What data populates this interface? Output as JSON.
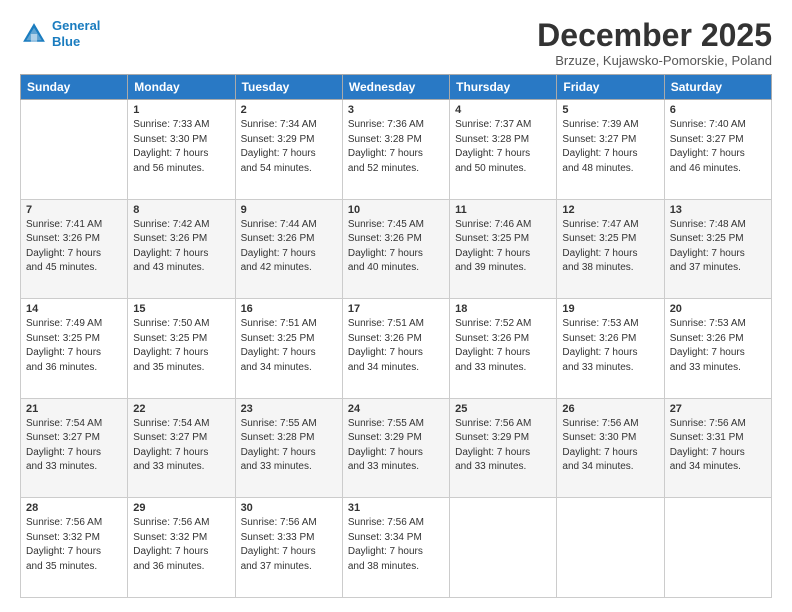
{
  "logo": {
    "line1": "General",
    "line2": "Blue"
  },
  "title": "December 2025",
  "location": "Brzuze, Kujawsko-Pomorskie, Poland",
  "weekdays": [
    "Sunday",
    "Monday",
    "Tuesday",
    "Wednesday",
    "Thursday",
    "Friday",
    "Saturday"
  ],
  "rows": [
    [
      {
        "day": "",
        "sunrise": "",
        "sunset": "",
        "daylight": ""
      },
      {
        "day": "1",
        "sunrise": "Sunrise: 7:33 AM",
        "sunset": "Sunset: 3:30 PM",
        "daylight": "Daylight: 7 hours and 56 minutes."
      },
      {
        "day": "2",
        "sunrise": "Sunrise: 7:34 AM",
        "sunset": "Sunset: 3:29 PM",
        "daylight": "Daylight: 7 hours and 54 minutes."
      },
      {
        "day": "3",
        "sunrise": "Sunrise: 7:36 AM",
        "sunset": "Sunset: 3:28 PM",
        "daylight": "Daylight: 7 hours and 52 minutes."
      },
      {
        "day": "4",
        "sunrise": "Sunrise: 7:37 AM",
        "sunset": "Sunset: 3:28 PM",
        "daylight": "Daylight: 7 hours and 50 minutes."
      },
      {
        "day": "5",
        "sunrise": "Sunrise: 7:39 AM",
        "sunset": "Sunset: 3:27 PM",
        "daylight": "Daylight: 7 hours and 48 minutes."
      },
      {
        "day": "6",
        "sunrise": "Sunrise: 7:40 AM",
        "sunset": "Sunset: 3:27 PM",
        "daylight": "Daylight: 7 hours and 46 minutes."
      }
    ],
    [
      {
        "day": "7",
        "sunrise": "Sunrise: 7:41 AM",
        "sunset": "Sunset: 3:26 PM",
        "daylight": "Daylight: 7 hours and 45 minutes."
      },
      {
        "day": "8",
        "sunrise": "Sunrise: 7:42 AM",
        "sunset": "Sunset: 3:26 PM",
        "daylight": "Daylight: 7 hours and 43 minutes."
      },
      {
        "day": "9",
        "sunrise": "Sunrise: 7:44 AM",
        "sunset": "Sunset: 3:26 PM",
        "daylight": "Daylight: 7 hours and 42 minutes."
      },
      {
        "day": "10",
        "sunrise": "Sunrise: 7:45 AM",
        "sunset": "Sunset: 3:26 PM",
        "daylight": "Daylight: 7 hours and 40 minutes."
      },
      {
        "day": "11",
        "sunrise": "Sunrise: 7:46 AM",
        "sunset": "Sunset: 3:25 PM",
        "daylight": "Daylight: 7 hours and 39 minutes."
      },
      {
        "day": "12",
        "sunrise": "Sunrise: 7:47 AM",
        "sunset": "Sunset: 3:25 PM",
        "daylight": "Daylight: 7 hours and 38 minutes."
      },
      {
        "day": "13",
        "sunrise": "Sunrise: 7:48 AM",
        "sunset": "Sunset: 3:25 PM",
        "daylight": "Daylight: 7 hours and 37 minutes."
      }
    ],
    [
      {
        "day": "14",
        "sunrise": "Sunrise: 7:49 AM",
        "sunset": "Sunset: 3:25 PM",
        "daylight": "Daylight: 7 hours and 36 minutes."
      },
      {
        "day": "15",
        "sunrise": "Sunrise: 7:50 AM",
        "sunset": "Sunset: 3:25 PM",
        "daylight": "Daylight: 7 hours and 35 minutes."
      },
      {
        "day": "16",
        "sunrise": "Sunrise: 7:51 AM",
        "sunset": "Sunset: 3:25 PM",
        "daylight": "Daylight: 7 hours and 34 minutes."
      },
      {
        "day": "17",
        "sunrise": "Sunrise: 7:51 AM",
        "sunset": "Sunset: 3:26 PM",
        "daylight": "Daylight: 7 hours and 34 minutes."
      },
      {
        "day": "18",
        "sunrise": "Sunrise: 7:52 AM",
        "sunset": "Sunset: 3:26 PM",
        "daylight": "Daylight: 7 hours and 33 minutes."
      },
      {
        "day": "19",
        "sunrise": "Sunrise: 7:53 AM",
        "sunset": "Sunset: 3:26 PM",
        "daylight": "Daylight: 7 hours and 33 minutes."
      },
      {
        "day": "20",
        "sunrise": "Sunrise: 7:53 AM",
        "sunset": "Sunset: 3:26 PM",
        "daylight": "Daylight: 7 hours and 33 minutes."
      }
    ],
    [
      {
        "day": "21",
        "sunrise": "Sunrise: 7:54 AM",
        "sunset": "Sunset: 3:27 PM",
        "daylight": "Daylight: 7 hours and 33 minutes."
      },
      {
        "day": "22",
        "sunrise": "Sunrise: 7:54 AM",
        "sunset": "Sunset: 3:27 PM",
        "daylight": "Daylight: 7 hours and 33 minutes."
      },
      {
        "day": "23",
        "sunrise": "Sunrise: 7:55 AM",
        "sunset": "Sunset: 3:28 PM",
        "daylight": "Daylight: 7 hours and 33 minutes."
      },
      {
        "day": "24",
        "sunrise": "Sunrise: 7:55 AM",
        "sunset": "Sunset: 3:29 PM",
        "daylight": "Daylight: 7 hours and 33 minutes."
      },
      {
        "day": "25",
        "sunrise": "Sunrise: 7:56 AM",
        "sunset": "Sunset: 3:29 PM",
        "daylight": "Daylight: 7 hours and 33 minutes."
      },
      {
        "day": "26",
        "sunrise": "Sunrise: 7:56 AM",
        "sunset": "Sunset: 3:30 PM",
        "daylight": "Daylight: 7 hours and 34 minutes."
      },
      {
        "day": "27",
        "sunrise": "Sunrise: 7:56 AM",
        "sunset": "Sunset: 3:31 PM",
        "daylight": "Daylight: 7 hours and 34 minutes."
      }
    ],
    [
      {
        "day": "28",
        "sunrise": "Sunrise: 7:56 AM",
        "sunset": "Sunset: 3:32 PM",
        "daylight": "Daylight: 7 hours and 35 minutes."
      },
      {
        "day": "29",
        "sunrise": "Sunrise: 7:56 AM",
        "sunset": "Sunset: 3:32 PM",
        "daylight": "Daylight: 7 hours and 36 minutes."
      },
      {
        "day": "30",
        "sunrise": "Sunrise: 7:56 AM",
        "sunset": "Sunset: 3:33 PM",
        "daylight": "Daylight: 7 hours and 37 minutes."
      },
      {
        "day": "31",
        "sunrise": "Sunrise: 7:56 AM",
        "sunset": "Sunset: 3:34 PM",
        "daylight": "Daylight: 7 hours and 38 minutes."
      },
      {
        "day": "",
        "sunrise": "",
        "sunset": "",
        "daylight": ""
      },
      {
        "day": "",
        "sunrise": "",
        "sunset": "",
        "daylight": ""
      },
      {
        "day": "",
        "sunrise": "",
        "sunset": "",
        "daylight": ""
      }
    ]
  ]
}
